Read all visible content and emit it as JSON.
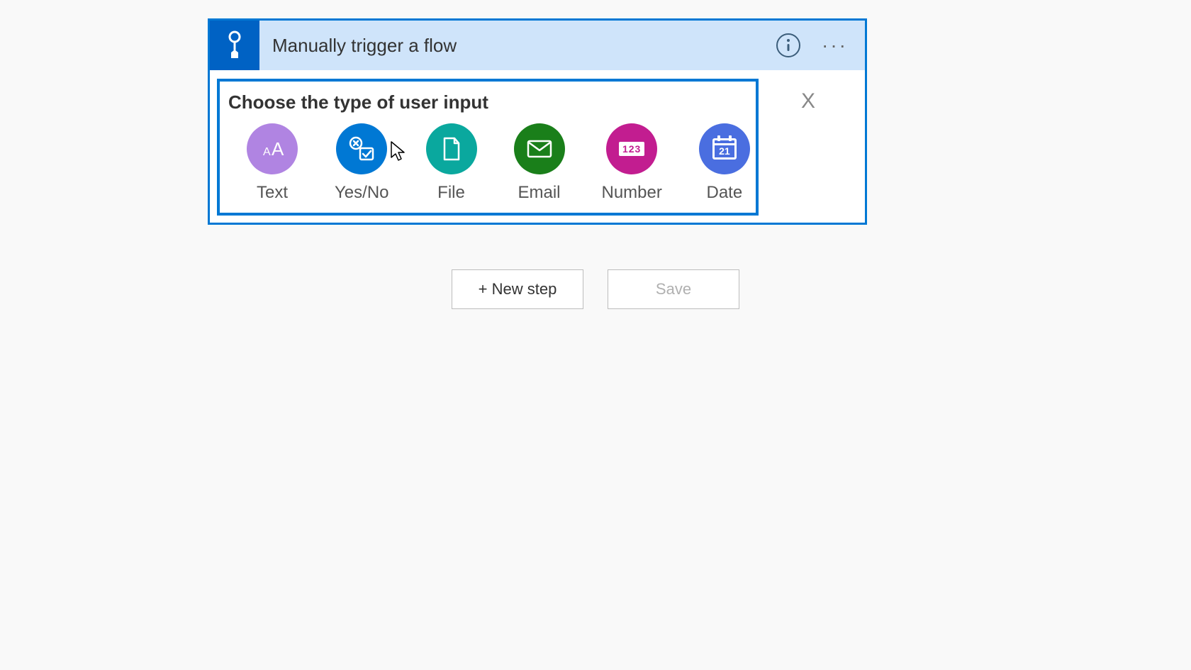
{
  "card": {
    "title": "Manually trigger a flow",
    "panel_title": "Choose the type of user input",
    "close_label": "X",
    "options": [
      {
        "label": "Text",
        "color": "c-text"
      },
      {
        "label": "Yes/No",
        "color": "c-yesno"
      },
      {
        "label": "File",
        "color": "c-file"
      },
      {
        "label": "Email",
        "color": "c-email"
      },
      {
        "label": "Number",
        "color": "c-number"
      },
      {
        "label": "Date",
        "color": "c-date"
      }
    ]
  },
  "actions": {
    "new_step": "+ New step",
    "save": "Save"
  },
  "icons": {
    "number_text": "123",
    "date_day": "21"
  }
}
